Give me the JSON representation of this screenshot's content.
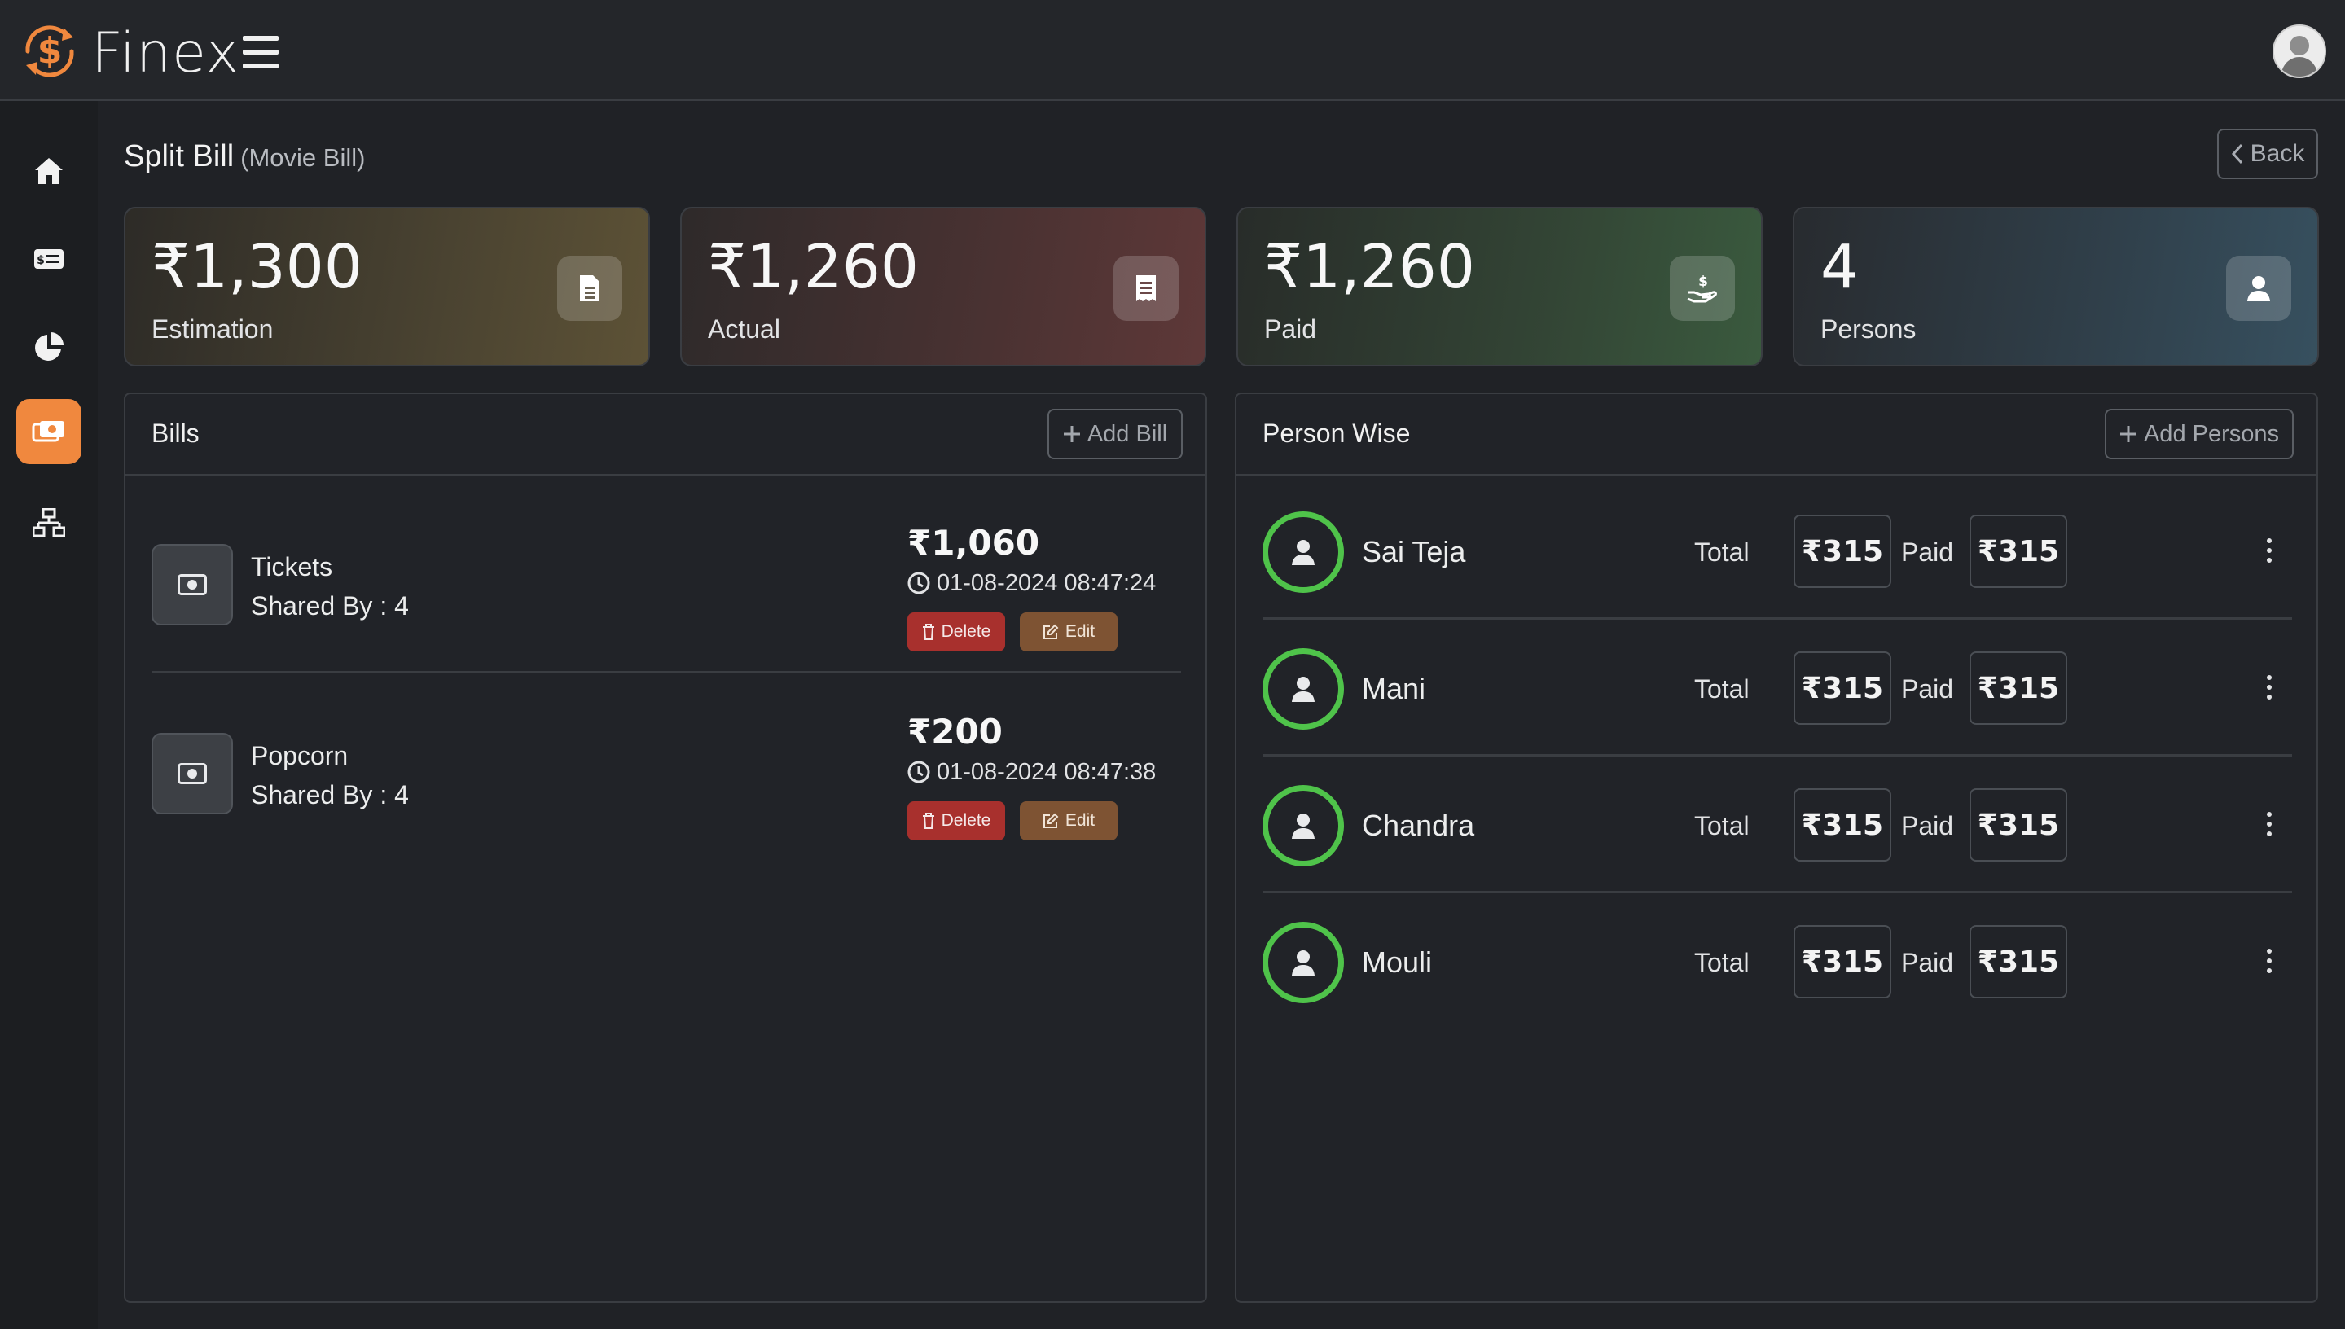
{
  "app": {
    "name": "Finex"
  },
  "page": {
    "title": "Split Bill",
    "subtitle": "(Movie Bill)",
    "back_label": "Back"
  },
  "stats": [
    {
      "value": "₹1,300",
      "label": "Estimation",
      "icon": "document-icon"
    },
    {
      "value": "₹1,260",
      "label": "Actual",
      "icon": "receipt-icon"
    },
    {
      "value": "₹1,260",
      "label": "Paid",
      "icon": "hand-dollar-icon"
    },
    {
      "value": "4",
      "label": "Persons",
      "icon": "person-icon"
    }
  ],
  "bills_panel": {
    "title": "Bills",
    "add_label": "Add Bill",
    "items": [
      {
        "name": "Tickets",
        "shared": "Shared By : 4",
        "amount": "₹1,060",
        "time": "01-08-2024 08:47:24",
        "delete_label": "Delete",
        "edit_label": "Edit"
      },
      {
        "name": "Popcorn",
        "shared": "Shared By : 4",
        "amount": "₹200",
        "time": "01-08-2024 08:47:38",
        "delete_label": "Delete",
        "edit_label": "Edit"
      }
    ]
  },
  "persons_panel": {
    "title": "Person Wise",
    "add_label": "Add Persons",
    "total_label": "Total",
    "paid_label": "Paid",
    "items": [
      {
        "name": "Sai Teja",
        "total": "₹315",
        "paid": "₹315"
      },
      {
        "name": "Mani",
        "total": "₹315",
        "paid": "₹315"
      },
      {
        "name": "Chandra",
        "total": "₹315",
        "paid": "₹315"
      },
      {
        "name": "Mouli",
        "total": "₹315",
        "paid": "₹315"
      }
    ]
  },
  "sidebar": {
    "items": [
      {
        "icon": "home-icon"
      },
      {
        "icon": "money-card-icon"
      },
      {
        "icon": "pie-chart-icon"
      },
      {
        "icon": "split-bill-icon",
        "active": true
      },
      {
        "icon": "sitemap-icon"
      }
    ]
  },
  "colors": {
    "accent": "#f0883e",
    "success": "#4fc34a",
    "danger": "#a8302d",
    "warning": "#7e5333"
  }
}
